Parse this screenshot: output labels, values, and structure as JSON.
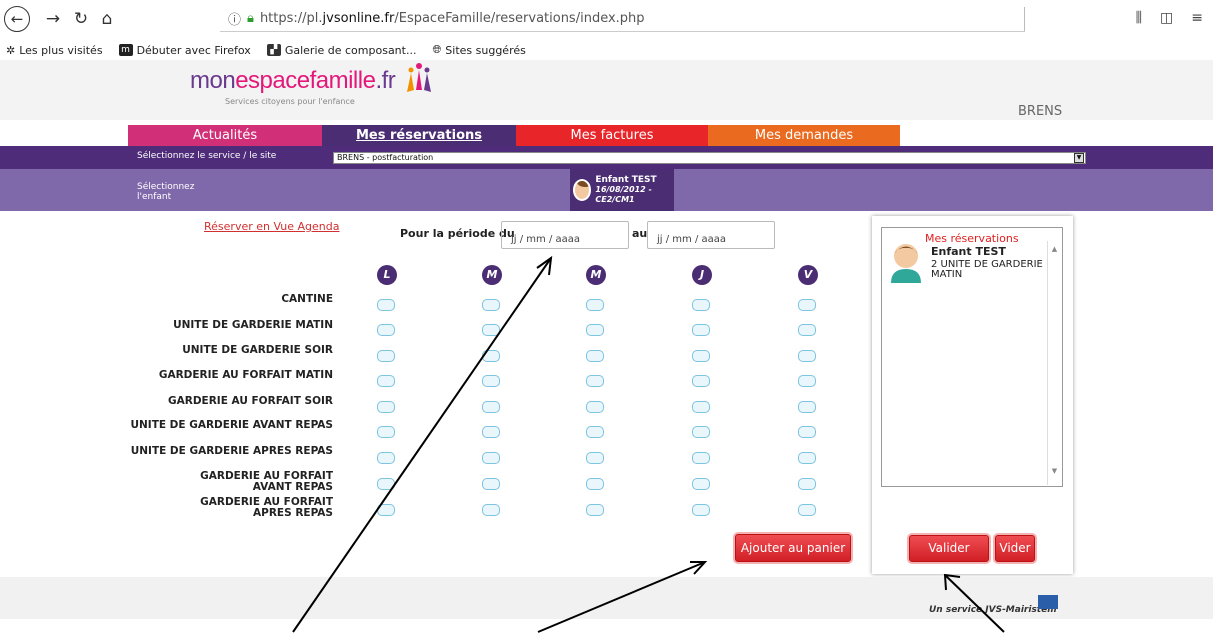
{
  "browser": {
    "url_prefix": "https://pl.",
    "url_host": "jvsonline.fr",
    "url_path": "/EspaceFamille/reservations/index.php",
    "bookmarks": [
      {
        "label": "Les plus visités"
      },
      {
        "label": "Débuter avec Firefox",
        "icon_text": "m"
      },
      {
        "label": "Galerie de composant..."
      },
      {
        "label": "Sites suggérés"
      }
    ]
  },
  "header": {
    "logo_part1": "mon",
    "logo_part2": "espacefamille",
    "logo_part3": ".fr",
    "tagline": "Services citoyens pour l'enfance",
    "town": "BRENS"
  },
  "tabs": [
    "Actualités",
    "Mes réservations",
    "Mes factures",
    "Mes demandes"
  ],
  "service": {
    "label": "Sélectionnez le service / le site",
    "selected": "BRENS - postfacturation"
  },
  "child_select": {
    "label": "Sélectionnez l'enfant",
    "name": "Enfant TEST",
    "info": "16/08/2012 - CE2/CM1"
  },
  "main": {
    "agenda_link": "Réserver en Vue Agenda",
    "period_label": "Pour la période du",
    "date_placeholder": "jj / mm / aaaa",
    "au_label": "au",
    "days": [
      "L",
      "M",
      "M",
      "J",
      "V"
    ],
    "rows": [
      "CANTINE",
      "UNITE DE GARDERIE MATIN",
      "UNITE DE GARDERIE SOIR",
      "GARDERIE AU FORFAIT MATIN",
      "GARDERIE AU FORFAIT SOIR",
      "UNITE DE GARDERIE AVANT REPAS",
      "UNITE DE GARDERIE APRES REPAS",
      "GARDERIE AU FORFAIT AVANT REPAS",
      "GARDERIE AU FORFAIT APRES REPAS"
    ],
    "add_cart": "Ajouter au panier"
  },
  "panel": {
    "title": "Mes réservations",
    "child": "Enfant TEST",
    "item": "2 UNITE DE GARDERIE MATIN",
    "validate": "Valider",
    "clear": "Vider"
  },
  "footer": {
    "text": "Un service JVS-Mairistem"
  }
}
